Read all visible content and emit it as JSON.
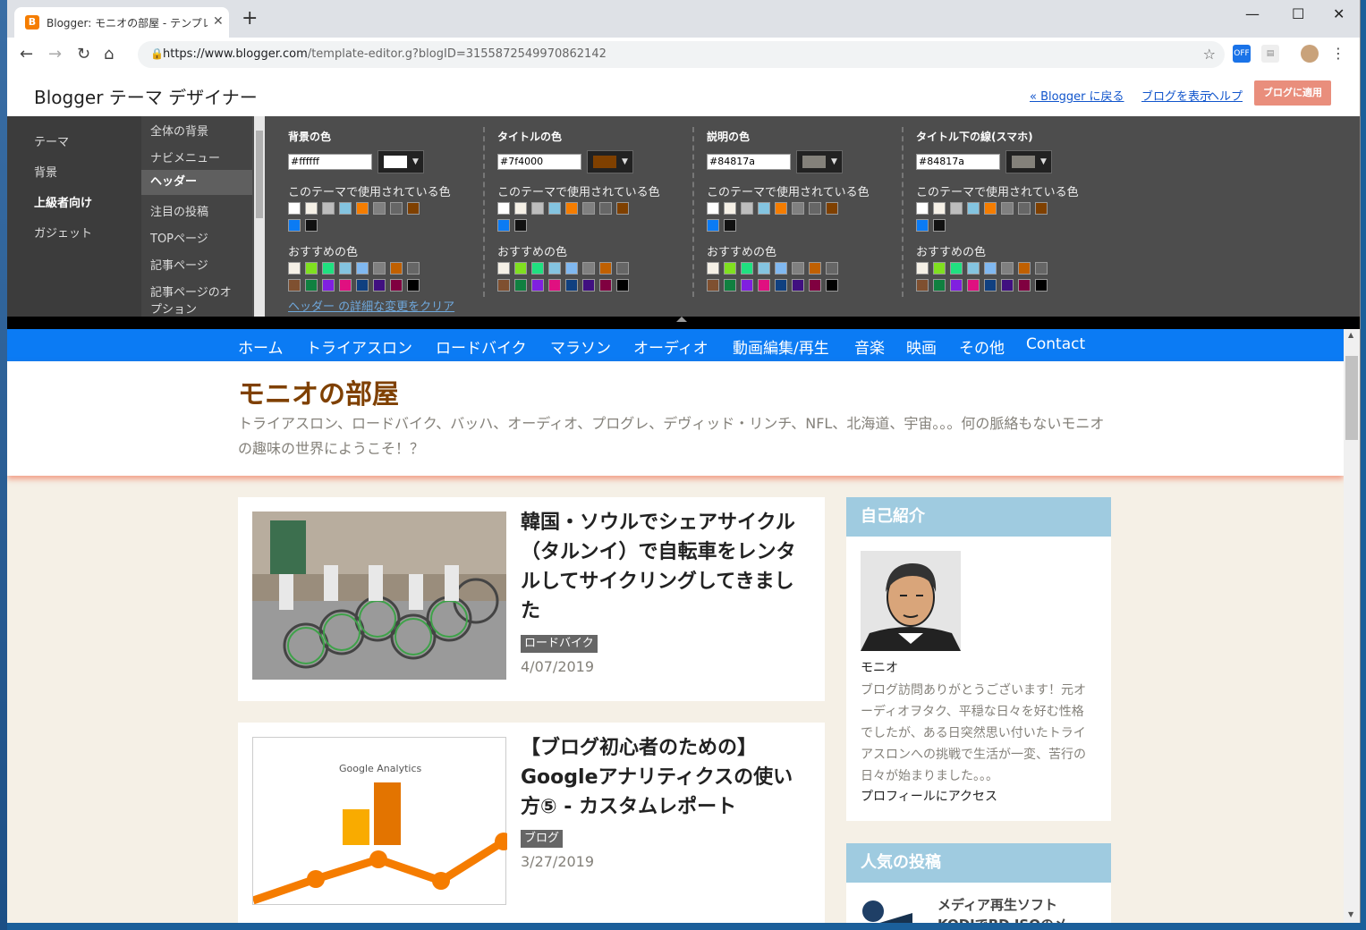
{
  "browser": {
    "tab_title": "Blogger: モニオの部屋 - テンプレート",
    "url_host": "https://www.blogger.com",
    "url_path": "/template-editor.g?blogID=3155872549970862142",
    "ext_badge": "OFF"
  },
  "header": {
    "title": "Blogger テーマ デザイナー",
    "links": [
      "« Blogger に戻る",
      "ブログを表示",
      "ヘルプ"
    ],
    "apply_label": "ブログに適用"
  },
  "leftnav": [
    "テーマ",
    "背景",
    "上級者向け",
    "ガジェット"
  ],
  "subnav": [
    "全体の背景",
    "ナビメニュー",
    "ヘッダー",
    "注目の投稿",
    "TOPページ",
    "記事ページ",
    "記事ページのオ",
    "プション"
  ],
  "color_groups": [
    {
      "title": "背景の色",
      "hex": "#ffffff",
      "swatch": "#ffffff"
    },
    {
      "title": "タイトルの色",
      "hex": "#7f4000",
      "swatch": "#7f4000"
    },
    {
      "title": "説明の色",
      "hex": "#84817a",
      "swatch": "#84817a"
    },
    {
      "title": "タイトル下の線(スマホ)",
      "hex": "#84817a",
      "swatch": "#84817a"
    }
  ],
  "used_label": "このテーマで使用されている色",
  "recommended_label": "おすすめの色",
  "used_colors": [
    "#ffffff",
    "#f5f0e6",
    "#bdbdbd",
    "#84c4e0",
    "#f57d00",
    "#808080",
    "#666666",
    "#7f4000",
    "#0b7bf4",
    "#111111"
  ],
  "recommended_colors": [
    "#f5f0e6",
    "#80e020",
    "#20e080",
    "#84c4e0",
    "#80b8f0",
    "#808080",
    "#c06000",
    "#666666",
    "#7f5030",
    "#108040",
    "#8020e0",
    "#e01080",
    "#104080",
    "#401080",
    "#800040",
    "#000000"
  ],
  "clear_link": "ヘッダー の詳細な変更をクリア",
  "blog": {
    "nav": [
      "ホーム",
      "トライアスロン",
      "ロードバイク",
      "マラソン",
      "オーディオ",
      "動画編集/再生",
      "音楽",
      "映画",
      "その他",
      "Contact"
    ],
    "title": "モニオの部屋",
    "description": "トライアスロン、ロードバイク、バッハ、オーディオ、プログレ、デヴィッド・リンチ、NFL、北海道、宇宙。。。何の脈絡もないモニオの趣味の世界にようこそ！？",
    "posts": [
      {
        "title": "韓国・ソウルでシェアサイクル（タルンイ）で自転車をレンタルしてサイクリングしてきました",
        "tag": "ロードバイク",
        "date": "4/07/2019"
      },
      {
        "title": "【ブログ初心者のための】Googleアナリティクスの使い方⑤ - カスタムレポート",
        "tag": "ブログ",
        "date": "3/27/2019",
        "image_caption": "Google Analytics"
      }
    ],
    "profile": {
      "widget_title": "自己紹介",
      "name": "モニオ",
      "text": "ブログ訪問ありがとうございます！元オーディオヲタク、平穏な日々を好む性格でしたが、ある日突然思い付いたトライアスロンへの挑戦で生活が一変、苦行の日々が始まりました。。。",
      "link": "プロフィールにアクセス"
    },
    "popular": {
      "widget_title": "人気の投稿",
      "first_item": "メディア再生ソフト KODIでBD ISOのメ"
    }
  }
}
